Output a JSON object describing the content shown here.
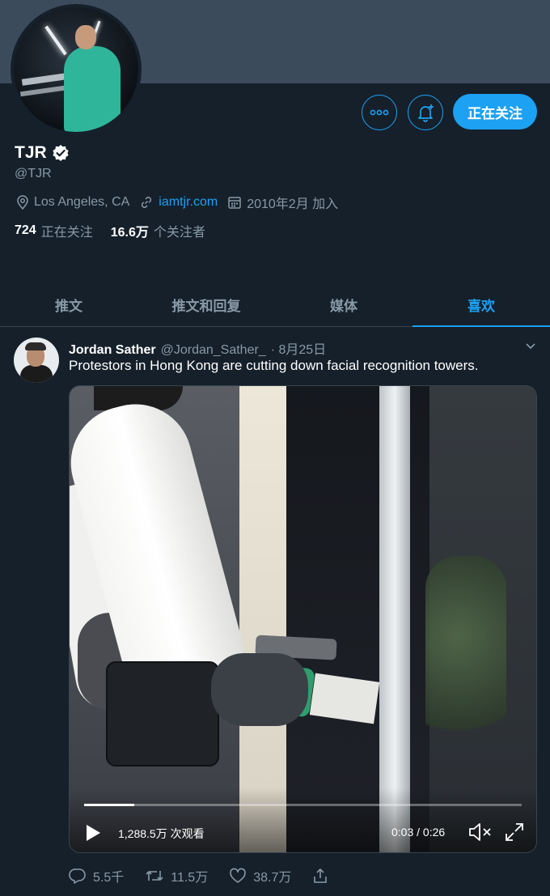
{
  "profile": {
    "name": "TJR",
    "handle": "@TJR",
    "location": "Los Angeles, CA",
    "website": "iamtjr.com",
    "joined": "2010年2月 加入",
    "following_count": "724",
    "following_label": "正在关注",
    "followers_count": "16.6万",
    "followers_label": "个关注者",
    "follow_button_label": "正在关注",
    "accent_color": "#1da1f2"
  },
  "tabs": [
    {
      "label": "推文",
      "active": false
    },
    {
      "label": "推文和回复",
      "active": false
    },
    {
      "label": "媒体",
      "active": false
    },
    {
      "label": "喜欢",
      "active": true
    }
  ],
  "tweet": {
    "author": "Jordan Sather",
    "handle": "@Jordan_Sather_",
    "date": "· 8月25日",
    "text": "Protestors in Hong Kong are cutting down facial recognition towers.",
    "video": {
      "views": "1,288.5万 次观看",
      "time": "0:03 / 0:26",
      "progress": 0.115
    },
    "actions": {
      "replies": "5.5千",
      "retweets": "11.5万",
      "likes": "38.7万"
    }
  },
  "icons": {
    "more": "more-icon",
    "bell": "notification-bell-icon",
    "verified": "verified-badge-icon",
    "location": "location-pin-icon",
    "link": "link-icon",
    "calendar": "calendar-icon",
    "caret": "chevron-down-icon",
    "play": "play-icon",
    "mute": "mute-icon",
    "fullscreen": "fullscreen-icon",
    "reply": "reply-icon",
    "retweet": "retweet-icon",
    "like": "like-icon",
    "share": "share-icon"
  }
}
